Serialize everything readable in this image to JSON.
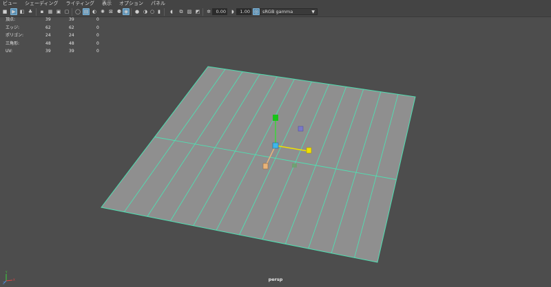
{
  "menu": {
    "items": [
      "ビュー",
      "シェーディング",
      "ライティング",
      "表示",
      "オプション",
      "パネル"
    ]
  },
  "toolbar": {
    "exposure_value": "0.00",
    "gamma_value": "1.00",
    "color_space": "sRGB gamma",
    "icons": [
      "camera-icon",
      "select-camera-icon",
      "camera-attributes-icon",
      "bookmark-icon",
      "image-plane-icon",
      "grid-icon",
      "film-gate-icon",
      "resolution-gate-icon",
      "gate-mask-icon",
      "field-chart-icon",
      "safe-action-icon",
      "wireframe-icon",
      "smooth-shade-icon",
      "bounding-box-icon",
      "textured-icon",
      "use-all-lights-icon",
      "shadows-icon",
      "xray-icon",
      "xray-joints-icon",
      "backface-culling-icon",
      "isolate-select-icon",
      "screen-space-ao-icon",
      "motion-blur-icon",
      "anti-alias-icon",
      "depth-of-field-icon",
      "exposure-icon",
      "gamma-icon",
      "color-management-icon"
    ]
  },
  "hud": {
    "rows": [
      {
        "label": "頂点:",
        "v1": "39",
        "v2": "39",
        "v3": "0"
      },
      {
        "label": "エッジ:",
        "v1": "62",
        "v2": "62",
        "v3": "0"
      },
      {
        "label": "ポリゴン:",
        "v1": "24",
        "v2": "24",
        "v3": "0"
      },
      {
        "label": "三角形:",
        "v1": "48",
        "v2": "48",
        "v3": "0"
      },
      {
        "label": "UV:",
        "v1": "39",
        "v2": "39",
        "v3": "0"
      }
    ]
  },
  "viewport": {
    "camera_name": "persp",
    "background_color": "#4d4d4d",
    "plane_fill_color": "#8f8f8f",
    "wire_color": "#4fe0b2",
    "plane_columns": 12,
    "plane_rows": 2
  },
  "axis": {
    "x_label": "X",
    "y_label": "Y",
    "z_label": "Z"
  }
}
